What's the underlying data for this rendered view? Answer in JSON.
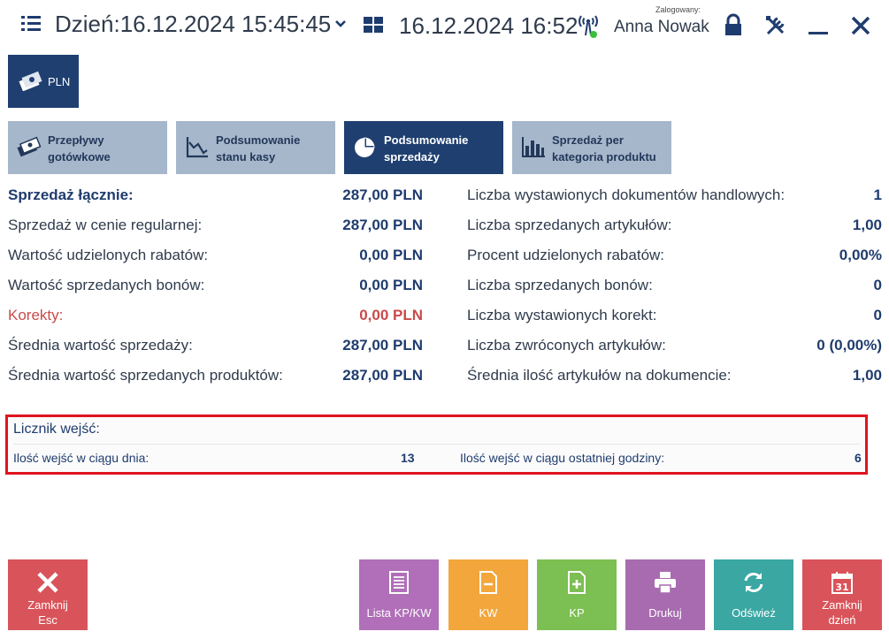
{
  "header": {
    "day_label": "Dzień:16.12.2024 15:45:45",
    "clock": "16.12.2024 16:52",
    "login_caption": "Zalogowany:",
    "user_name": "Anna Nowak",
    "icons": [
      "menu-icon",
      "chevron-down-icon",
      "windows-icon",
      "network-icon",
      "lock-icon",
      "tools-icon",
      "minimize-icon",
      "close-icon"
    ]
  },
  "currency": {
    "label": "PLN",
    "icon": "money-icon"
  },
  "tabs": [
    {
      "line1": "Przepływy",
      "line2": "gotówkowe",
      "icon": "money-icon",
      "active": false
    },
    {
      "line1": "Podsumowanie",
      "line2": "stanu kasy",
      "icon": "line-chart-icon",
      "active": false
    },
    {
      "line1": "Podsumowanie",
      "line2": "sprzedaży",
      "icon": "pie-chart-icon",
      "active": true
    },
    {
      "line1": "Sprzedaż per",
      "line2": "kategoria produktu",
      "icon": "bar-chart-icon",
      "active": false
    }
  ],
  "sales_left": [
    {
      "label": "Sprzedaż łącznie:",
      "value": "287,00 PLN"
    },
    {
      "label": "Sprzedaż w cenie regularnej:",
      "value": "287,00 PLN"
    },
    {
      "label": "Wartość udzielonych rabatów:",
      "value": "0,00 PLN"
    },
    {
      "label": "Wartość sprzedanych bonów:",
      "value": "0,00 PLN"
    },
    {
      "label": "Korekty:",
      "value": "0,00 PLN"
    },
    {
      "label": "Średnia wartość sprzedaży:",
      "value": "287,00 PLN"
    },
    {
      "label": "Średnia wartość sprzedanych produktów:",
      "value": "287,00 PLN"
    }
  ],
  "sales_right": [
    {
      "label": "Liczba wystawionych dokumentów handlowych:",
      "value": "1"
    },
    {
      "label": "Liczba sprzedanych artykułów:",
      "value": "1,00"
    },
    {
      "label": "Procent udzielonych rabatów:",
      "value": "0,00%"
    },
    {
      "label": "Liczba sprzedanych bonów:",
      "value": "0"
    },
    {
      "label": "Liczba wystawionych korekt:",
      "value": "0"
    },
    {
      "label": "Liczba zwróconych artykułów:",
      "value": "0 (0,00%)"
    },
    {
      "label": "Średnia ilość artykułów na dokumencie:",
      "value": "1,00"
    }
  ],
  "counter": {
    "title": "Licznik wejść:",
    "daily_label": "Ilość wejść w ciągu dnia:",
    "daily_value": "13",
    "hourly_label": "Ilość wejść w ciągu ostatniej godziny:",
    "hourly_value": "6"
  },
  "buttons": {
    "close": {
      "line1": "Zamknij",
      "line2": "Esc",
      "color": "#d9545a"
    },
    "list": {
      "label": "Lista KP/KW",
      "color": "#b06fb8"
    },
    "kw": {
      "label": "KW",
      "color": "#f2a63c"
    },
    "kp": {
      "label": "KP",
      "color": "#7cbf52"
    },
    "print": {
      "label": "Drukuj",
      "color": "#a86bb0"
    },
    "refresh": {
      "label": "Odśwież",
      "color": "#3aa7a3"
    },
    "close_day": {
      "line1": "Zamknij",
      "line2": "dzień",
      "color": "#d9545a"
    }
  },
  "colors": {
    "navy": "#1f3f70",
    "tab_inactive": "#a6b7cb",
    "correction": "#c94a4a",
    "highlight": "#e0141e"
  }
}
